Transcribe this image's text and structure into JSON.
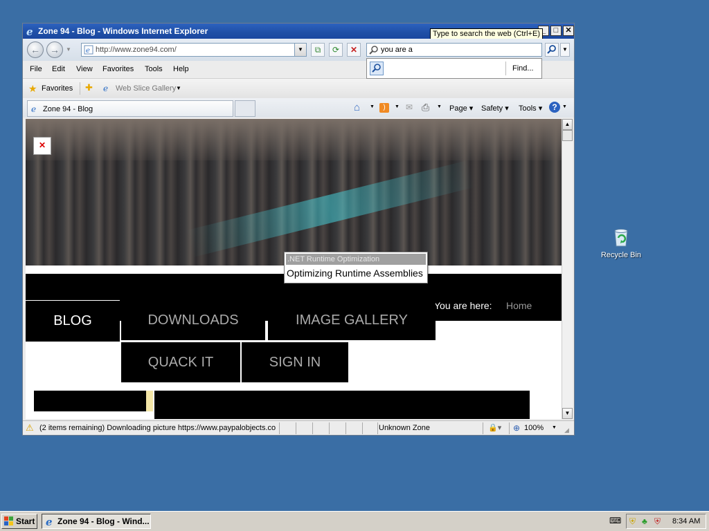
{
  "desktop": {
    "recycle_bin": "Recycle Bin"
  },
  "window": {
    "title": "Zone 94 - Blog - Windows Internet Explorer",
    "tooltip": "Type to search the web (Ctrl+E)"
  },
  "address": {
    "url": "http://www.zone94.com/"
  },
  "search": {
    "value": "you are a",
    "find_label": "Find..."
  },
  "menu": [
    "File",
    "Edit",
    "View",
    "Favorites",
    "Tools",
    "Help"
  ],
  "favorites": {
    "label": "Favorites",
    "web_slice": "Web Slice Gallery"
  },
  "tab": {
    "title": "Zone 94 - Blog"
  },
  "commands": {
    "page": "Page",
    "safety": "Safety",
    "tools": "Tools"
  },
  "site": {
    "nav": {
      "blog": "BLOG",
      "downloads": "DOWNLOADS",
      "gallery": "IMAGE GALLERY",
      "quack": "QUACK IT",
      "signin": "SIGN IN"
    },
    "breadcrumb": {
      "prefix": "You are here:",
      "home": "Home"
    }
  },
  "popup": {
    "title": ".NET Runtime Optimization",
    "body": "Optimizing Runtime Assemblies"
  },
  "status": {
    "message": "(2 items remaining) Downloading picture https://www.paypalobjects.co",
    "zone": "Unknown Zone",
    "zoom": "100%"
  },
  "taskbar": {
    "start": "Start",
    "task_ie": "Zone 94 - Blog - Wind...",
    "clock": "8:34 AM"
  },
  "colors": {
    "desktop": "#3a6ea5",
    "titlebar": "#1f4fa6",
    "tooltip_bg": "#ffffe1"
  }
}
